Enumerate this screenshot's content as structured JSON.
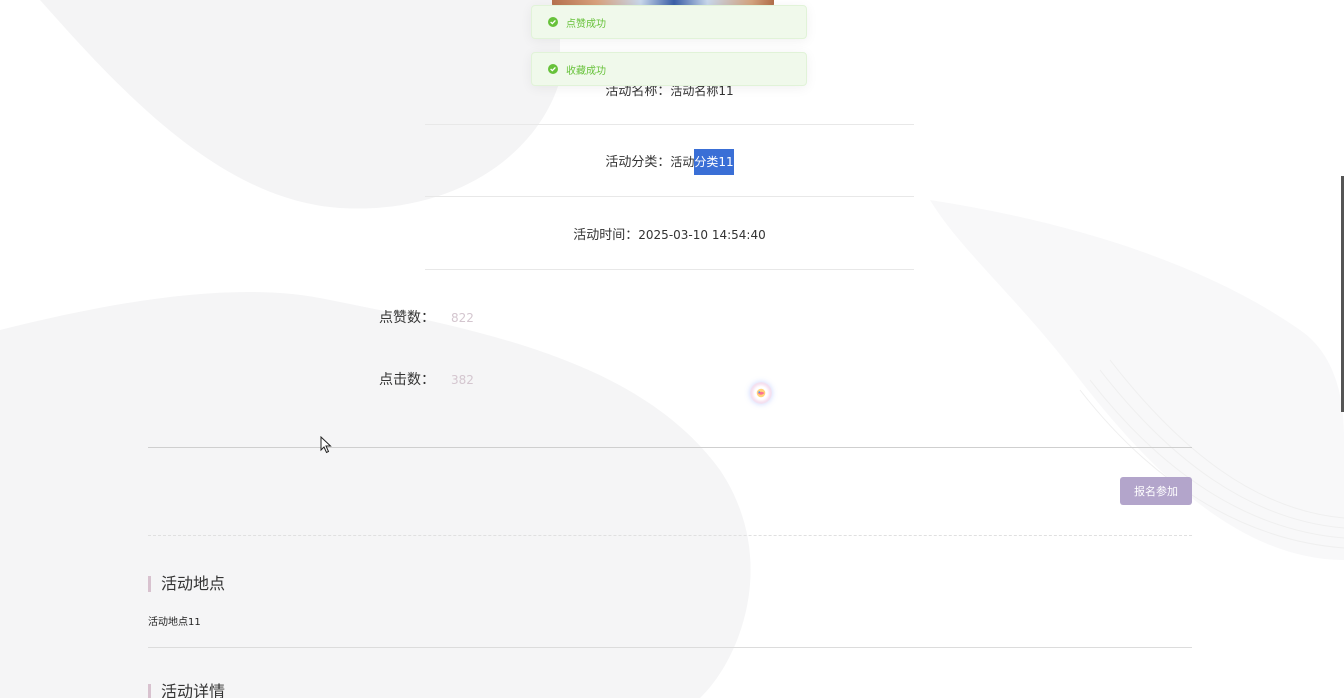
{
  "toasts": [
    {
      "message": "点赞成功"
    },
    {
      "message": "收藏成功"
    }
  ],
  "activity": {
    "name_label": "活动名称：",
    "name_value": "活动名称11",
    "category_label": "活动分类：",
    "category_value_pre": "活动",
    "category_value_selected": "分类11",
    "time_label": "活动时间：",
    "time_value": "2025-03-10 14:54:40"
  },
  "stats": {
    "likes_label": "点赞数：",
    "likes_value": "822",
    "clicks_label": "点击数：",
    "clicks_value": "382"
  },
  "actions": {
    "signup_label": "报名参加"
  },
  "location": {
    "title": "活动地点",
    "value": "活动地点11"
  },
  "details": {
    "title": "活动详情"
  },
  "colors": {
    "success": "#67c23a",
    "selection": "#3a6fd6",
    "button": "#b3a5cb",
    "accent_bar": "#d8c2cf"
  },
  "icons": {
    "toast_icon": "check-circle-icon",
    "cursor": "mouse-pointer-icon"
  }
}
